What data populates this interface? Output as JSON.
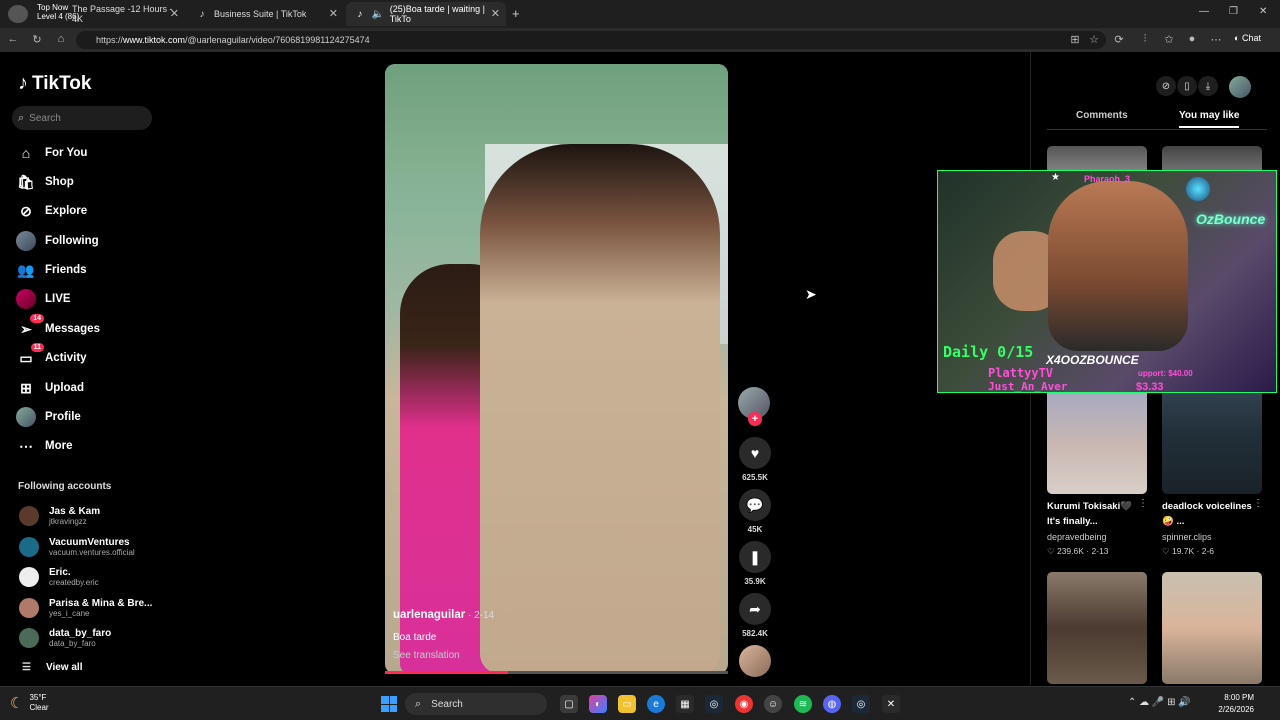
{
  "browser": {
    "tabs": [
      {
        "label": "Top Now\nLevel 4 (86)",
        "sub": "The Passage -12 Hours - 4K",
        "active": false
      },
      {
        "label": "Business Suite | TikTok",
        "active": false
      },
      {
        "label": "(25)Boa tarde | waiting | TikTo",
        "active": true
      }
    ],
    "overlay_top": "Top Now",
    "overlay_level": "Level 4 (86)",
    "tab1_title": "The Passage -12 Hours - 4K",
    "url_prefix": "https://",
    "url_host": "www.tiktok.com",
    "url_path": "/@uarlenaguilar/video/7606819981124275474",
    "chat_label": "Chat"
  },
  "nav": {
    "brand": "TikTok",
    "search_placeholder": "Search",
    "items": [
      {
        "label": "For You",
        "icon": "home-icon"
      },
      {
        "label": "Shop",
        "icon": "shop-icon"
      },
      {
        "label": "Explore",
        "icon": "compass-icon"
      },
      {
        "label": "Following",
        "icon": "following-avatar-icon"
      },
      {
        "label": "Friends",
        "icon": "friends-icon"
      },
      {
        "label": "LIVE",
        "icon": "live-icon"
      },
      {
        "label": "Messages",
        "icon": "messages-icon",
        "badge": "14"
      },
      {
        "label": "Activity",
        "icon": "activity-icon",
        "badge": "11"
      },
      {
        "label": "Upload",
        "icon": "upload-icon"
      },
      {
        "label": "Profile",
        "icon": "profile-icon"
      },
      {
        "label": "More",
        "icon": "more-icon"
      }
    ],
    "following_title": "Following accounts",
    "following": [
      {
        "name": "Jas & Kam",
        "handle": "jtkravingzz",
        "color": "#5a3a2a"
      },
      {
        "name": "VacuumVentures",
        "handle": "vacuum.ventures.official",
        "color": "#1a6a8a"
      },
      {
        "name": "Eric.",
        "handle": "createdby.eric",
        "color": "#eeeeee"
      },
      {
        "name": "Parisa & Mina & Bre...",
        "handle": "yes_i_cane",
        "color": "#b07a6a"
      },
      {
        "name": "data_by_faro",
        "handle": "data_by_faro",
        "color": "#4a6a5a"
      }
    ],
    "view_all": "View all"
  },
  "video": {
    "username": "uarlenaguilar",
    "date": " · 2-14",
    "caption": "Boa tarde",
    "translate": "See translation",
    "progress": 0.36,
    "likes": "625.5K",
    "comments": "45K",
    "saves": "35.9K",
    "shares": "582.4K"
  },
  "right": {
    "tab_comments": "Comments",
    "tab_you_may_like": "You may like",
    "cards": [
      {
        "title": "Kurumi Tokisaki🖤 It's finally...",
        "author": "depravedbeing",
        "likes": "♡ 239.6K · 2-13"
      },
      {
        "title": "deadlock voicelines🤪 ...",
        "author": "spinner.clips",
        "likes": "♡ 19.7K · 2-6"
      }
    ]
  },
  "stream": {
    "channel": "Pharaoh_3",
    "daily": "Daily 0/15",
    "streamer": "X4OOZBOUNCE",
    "sub1": "PlattyyTV",
    "sub2": "Just_An_Aver",
    "support": "upport: $40.00",
    "tip": "$3.33",
    "neon": "OzBounce"
  },
  "taskbar": {
    "temp": "35°F",
    "condition": "Clear",
    "search": "Search",
    "time": "8:00 PM",
    "date": "2/26/2026"
  }
}
